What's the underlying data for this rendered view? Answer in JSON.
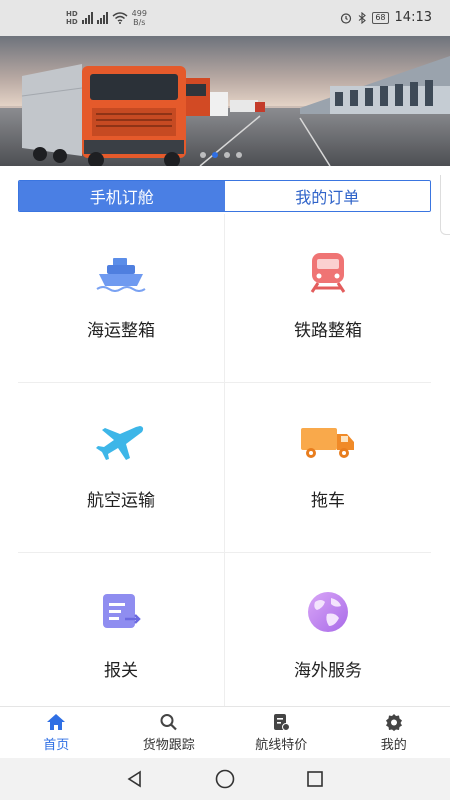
{
  "status_bar": {
    "network_labels": [
      "HD",
      "HD"
    ],
    "speed_value": "499",
    "speed_unit": "B/s",
    "battery": "68",
    "time": "14:13"
  },
  "banner": {
    "slide_count": 4,
    "active_slide": 1
  },
  "tabs": [
    {
      "label": "手机订舱",
      "active": true
    },
    {
      "label": "我的订单",
      "active": false
    }
  ],
  "services": [
    {
      "label": "海运整箱",
      "icon": "ship-icon"
    },
    {
      "label": "铁路整箱",
      "icon": "train-icon"
    },
    {
      "label": "航空运输",
      "icon": "airplane-icon"
    },
    {
      "label": "拖车",
      "icon": "truck-icon"
    },
    {
      "label": "报关",
      "icon": "customs-document-icon"
    },
    {
      "label": "海外服务",
      "icon": "globe-icon"
    }
  ],
  "bottom_nav": [
    {
      "label": "首页",
      "icon": "home-icon",
      "active": true
    },
    {
      "label": "货物跟踪",
      "icon": "search-icon",
      "active": false
    },
    {
      "label": "航线特价",
      "icon": "route-price-icon",
      "active": false
    },
    {
      "label": "我的",
      "icon": "profile-gear-icon",
      "active": false
    }
  ],
  "colors": {
    "accent": "#2f6fe4",
    "tab_active_bg": "#4a7fe4"
  }
}
